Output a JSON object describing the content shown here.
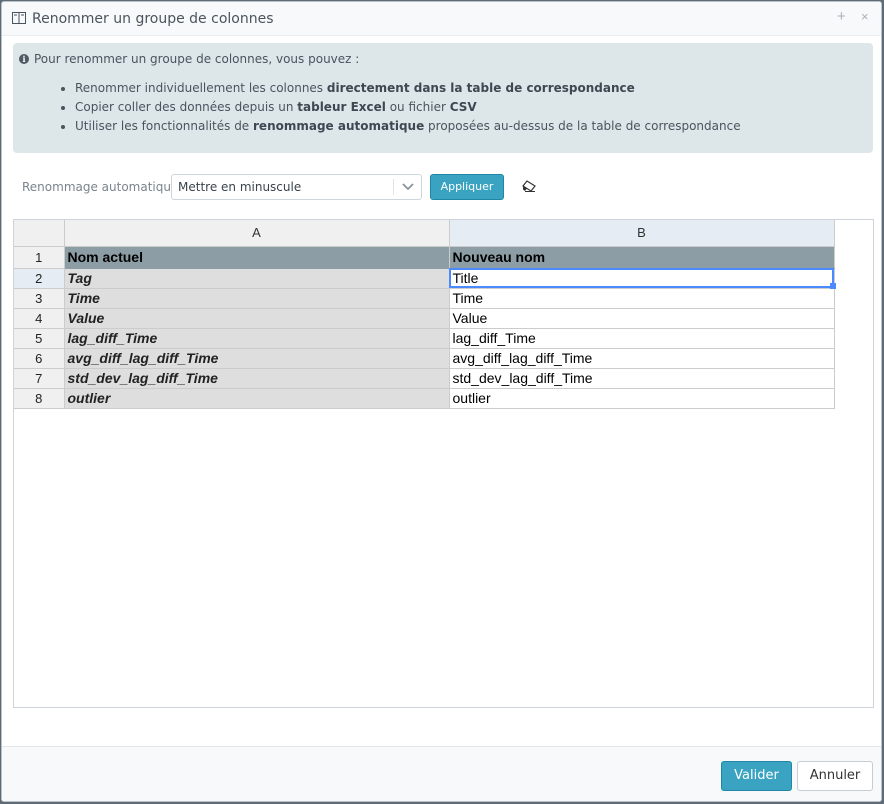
{
  "dialog": {
    "title": "Renommer un groupe de colonnes",
    "title_icon": "columns-icon",
    "maximize_label": "+",
    "close_label": "×"
  },
  "info": {
    "icon": "info-circle-icon",
    "intro": "Pour renommer un groupe de colonnes, vous pouvez :",
    "items": [
      {
        "prefix": "Renommer individuellement les colonnes ",
        "strong": "directement dans la table de correspondance",
        "suffix": ""
      },
      {
        "prefix": "Copier coller des données depuis un ",
        "strong": "tableur Excel",
        "middle": " ou fichier ",
        "strong2": "CSV"
      },
      {
        "prefix": "Utiliser les fonctionnalités de ",
        "strong": "renommage automatique",
        "suffix": " proposées au-dessus de la table de correspondance"
      }
    ]
  },
  "auto_rename": {
    "label": "Renommage automatique",
    "selected": "Mettre en minuscule",
    "chevron_icon": "chevron-down-icon",
    "apply_label": "Appliquer",
    "clear_icon": "eraser-icon"
  },
  "grid": {
    "columns": [
      "A",
      "B"
    ],
    "rows": [
      {
        "num": "1",
        "a": "Nom actuel",
        "b": "Nouveau nom"
      },
      {
        "num": "2",
        "a": "Tag",
        "b": "Title"
      },
      {
        "num": "3",
        "a": "Time",
        "b": "Time"
      },
      {
        "num": "4",
        "a": "Value",
        "b": "Value"
      },
      {
        "num": "5",
        "a": "lag_diff_Time",
        "b": "lag_diff_Time"
      },
      {
        "num": "6",
        "a": "avg_diff_lag_diff_Time",
        "b": "avg_diff_lag_diff_Time"
      },
      {
        "num": "7",
        "a": "std_dev_lag_diff_Time",
        "b": "std_dev_lag_diff_Time"
      },
      {
        "num": "8",
        "a": "outlier",
        "b": "outlier"
      }
    ],
    "selected_cell": "B2"
  },
  "footer": {
    "validate_label": "Valider",
    "cancel_label": "Annuler"
  },
  "colors": {
    "primary": "#3aa3c2",
    "info_bg": "#dde6e9",
    "header_row_bg": "#8d9da5",
    "selection": "#4b89ff"
  }
}
